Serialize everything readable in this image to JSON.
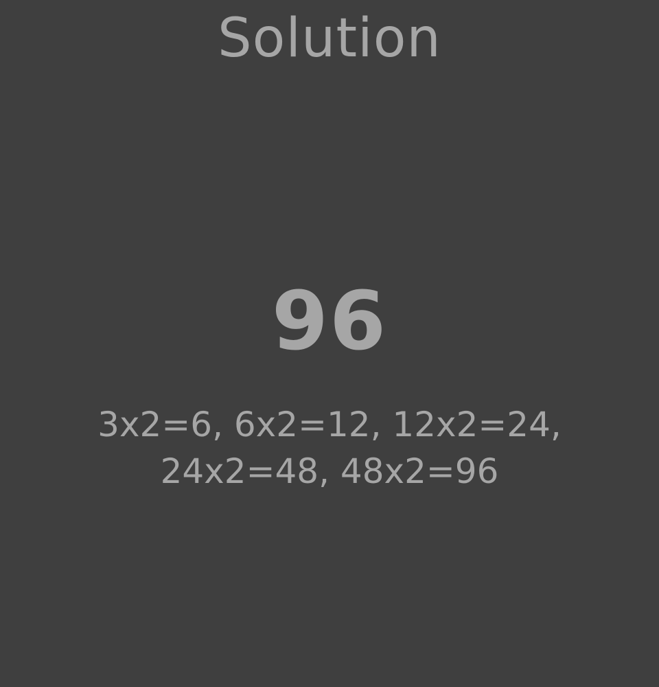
{
  "solution_screen": {
    "title": "Solution",
    "answer": "96",
    "explanation": "3x2=6, 6x2=12, 12x2=24, 24x2=48, 48x2=96"
  },
  "colors": {
    "background": "#3f3f3f",
    "text": "#a6a6a6"
  }
}
